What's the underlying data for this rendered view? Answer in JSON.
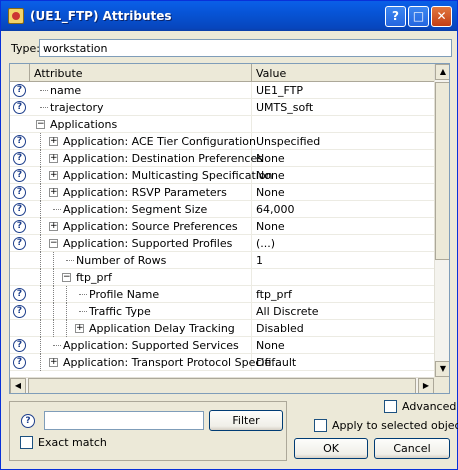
{
  "window": {
    "title": "(UE1_FTP) Attributes",
    "help_btn": "?",
    "maximize_btn": "□",
    "close_btn": "✕"
  },
  "type_field": {
    "label": "Type:",
    "value": "workstation"
  },
  "grid": {
    "columns": [
      "Attribute",
      "Value"
    ],
    "rows": [
      {
        "label": "name",
        "value": "UE1_FTP",
        "help": true,
        "depth": 0,
        "expander": "none"
      },
      {
        "label": "trajectory",
        "value": "UMTS_soft",
        "help": true,
        "depth": 0,
        "expander": "none"
      },
      {
        "label": "Applications",
        "value": "",
        "help": false,
        "depth": 0,
        "expander": "minus"
      },
      {
        "label": "Application: ACE Tier Configuration",
        "value": "Unspecified",
        "help": true,
        "depth": 1,
        "expander": "plus"
      },
      {
        "label": "Application: Destination Preferences",
        "value": "None",
        "help": true,
        "depth": 1,
        "expander": "plus"
      },
      {
        "label": "Application: Multicasting Specification",
        "value": "None",
        "help": true,
        "depth": 1,
        "expander": "plus"
      },
      {
        "label": "Application: RSVP Parameters",
        "value": "None",
        "help": true,
        "depth": 1,
        "expander": "plus"
      },
      {
        "label": "Application: Segment Size",
        "value": "64,000",
        "help": true,
        "depth": 1,
        "expander": "none"
      },
      {
        "label": "Application: Source Preferences",
        "value": "None",
        "help": true,
        "depth": 1,
        "expander": "plus"
      },
      {
        "label": "Application: Supported Profiles",
        "value": "(...)",
        "help": true,
        "depth": 1,
        "expander": "minus"
      },
      {
        "label": "Number of Rows",
        "value": "1",
        "help": false,
        "depth": 2,
        "expander": "none"
      },
      {
        "label": "ftp_prf",
        "value": "",
        "help": false,
        "depth": 2,
        "expander": "minus"
      },
      {
        "label": "Profile Name",
        "value": "ftp_prf",
        "help": true,
        "depth": 3,
        "expander": "none"
      },
      {
        "label": "Traffic Type",
        "value": "All Discrete",
        "help": true,
        "depth": 3,
        "expander": "none"
      },
      {
        "label": "Application Delay Tracking",
        "value": "Disabled",
        "help": false,
        "depth": 3,
        "expander": "plus"
      },
      {
        "label": "Application: Supported Services",
        "value": "None",
        "help": true,
        "depth": 1,
        "expander": "none"
      },
      {
        "label": "Application: Transport Protocol Specifi...",
        "value": "Default",
        "help": true,
        "depth": 1,
        "expander": "plus"
      }
    ]
  },
  "bottom": {
    "help": "?",
    "filter_value": "",
    "filter_button": "Filter",
    "exact_match": "Exact match",
    "advanced": "Advanced",
    "apply_selected": "Apply to selected objects",
    "ok": "OK",
    "cancel": "Cancel"
  }
}
